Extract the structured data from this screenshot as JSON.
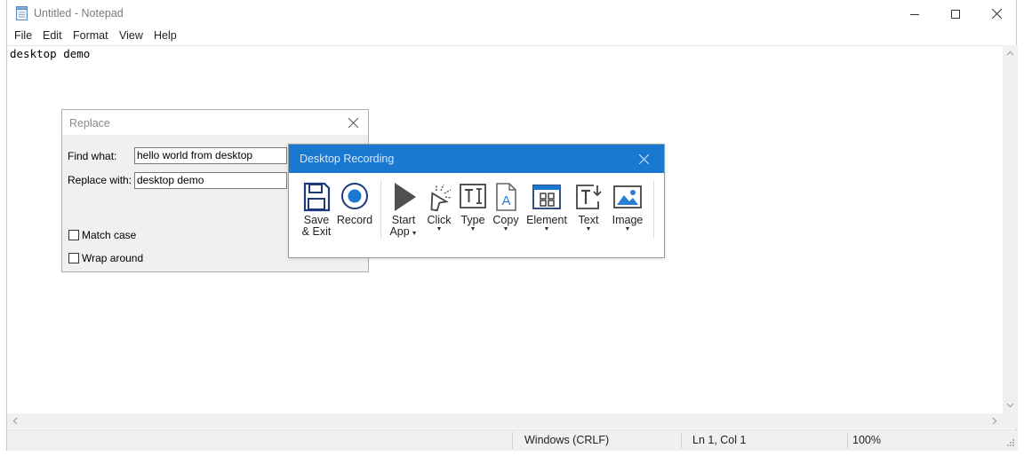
{
  "notepad": {
    "title": "Untitled - Notepad",
    "menu": [
      "File",
      "Edit",
      "Format",
      "View",
      "Help"
    ],
    "content": "desktop demo",
    "status": {
      "line_ending": "Windows (CRLF)",
      "position": "Ln 1, Col 1",
      "zoom": "100%"
    }
  },
  "replace_dialog": {
    "title": "Replace",
    "find_label": "Find what:",
    "find_value": "hello world from desktop",
    "replace_label": "Replace with:",
    "replace_value": "desktop demo",
    "match_case_label": "Match case",
    "match_case_checked": false,
    "wrap_around_label": "Wrap around",
    "wrap_around_checked": false
  },
  "recording": {
    "title": "Desktop Recording",
    "accent": "#1979d1",
    "tools": {
      "save_exit": {
        "line1": "Save",
        "line2": "& Exit",
        "icon": "floppy-disk-icon"
      },
      "record": {
        "label": "Record",
        "icon": "record-icon"
      },
      "start_app": {
        "line1": "Start",
        "line2": "App",
        "icon": "play-icon"
      },
      "click": {
        "label": "Click",
        "icon": "cursor-click-icon"
      },
      "type": {
        "label": "Type",
        "icon": "text-cursor-icon"
      },
      "copy": {
        "label": "Copy",
        "icon": "document-a-icon"
      },
      "element": {
        "label": "Element",
        "icon": "window-grid-icon"
      },
      "text": {
        "label": "Text",
        "icon": "text-arrow-icon"
      },
      "image": {
        "label": "Image",
        "icon": "image-icon"
      }
    }
  }
}
